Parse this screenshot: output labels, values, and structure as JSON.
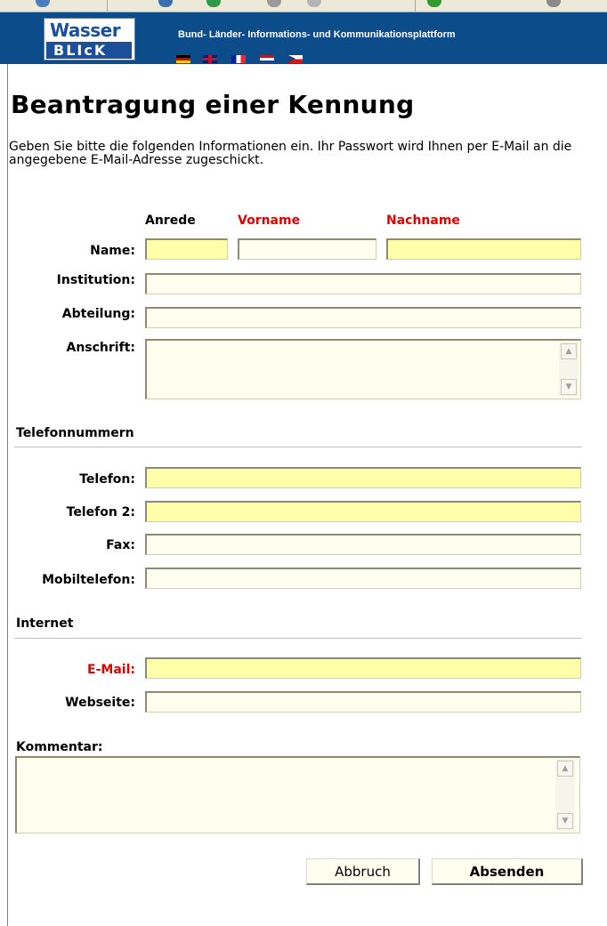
{
  "banner": {
    "logo_top": "Wasser",
    "logo_bottom": "BLIcK",
    "platform_title": "Bund- Länder- Informations- und Kommunikationsplattform"
  },
  "page": {
    "title": "Beantragung einer Kennung",
    "intro": "Geben Sie bitte die folgenden Informationen ein. Ihr Passwort wird Ihnen per E-Mail an die angegebene E-Mail-Adresse zugeschickt."
  },
  "form": {
    "columns": {
      "anrede": "Anrede",
      "vorname": "Vorname",
      "nachname": "Nachname"
    },
    "labels": {
      "name": "Name:",
      "institution": "Institution:",
      "abteilung": "Abteilung:",
      "anschrift": "Anschrift:",
      "telefon": "Telefon:",
      "telefon2": "Telefon 2:",
      "fax": "Fax:",
      "mobiltelefon": "Mobiltelefon:",
      "email": "E-Mail:",
      "webseite": "Webseite:",
      "kommentar": "Kommentar:"
    },
    "values": {
      "anrede": "",
      "vorname": "",
      "nachname": "",
      "institution": "",
      "abteilung": "",
      "anschrift": "",
      "telefon": "",
      "telefon2": "",
      "fax": "",
      "mobiltelefon": "",
      "email": "",
      "webseite": "",
      "kommentar": ""
    }
  },
  "sections": {
    "telefon": "Telefonnummern",
    "internet": "Internet"
  },
  "buttons": {
    "cancel": "Abbruch",
    "submit": "Absenden"
  },
  "colors": {
    "banner_bg": "#0d4c8b",
    "required_label": "#e00000",
    "field_required_bg": "#ffffaa",
    "field_bg": "#fffff0"
  },
  "icons": {
    "flags": [
      "flag-de-icon",
      "flag-gb-icon",
      "flag-fr-icon",
      "flag-nl-icon",
      "flag-cz-icon"
    ]
  }
}
